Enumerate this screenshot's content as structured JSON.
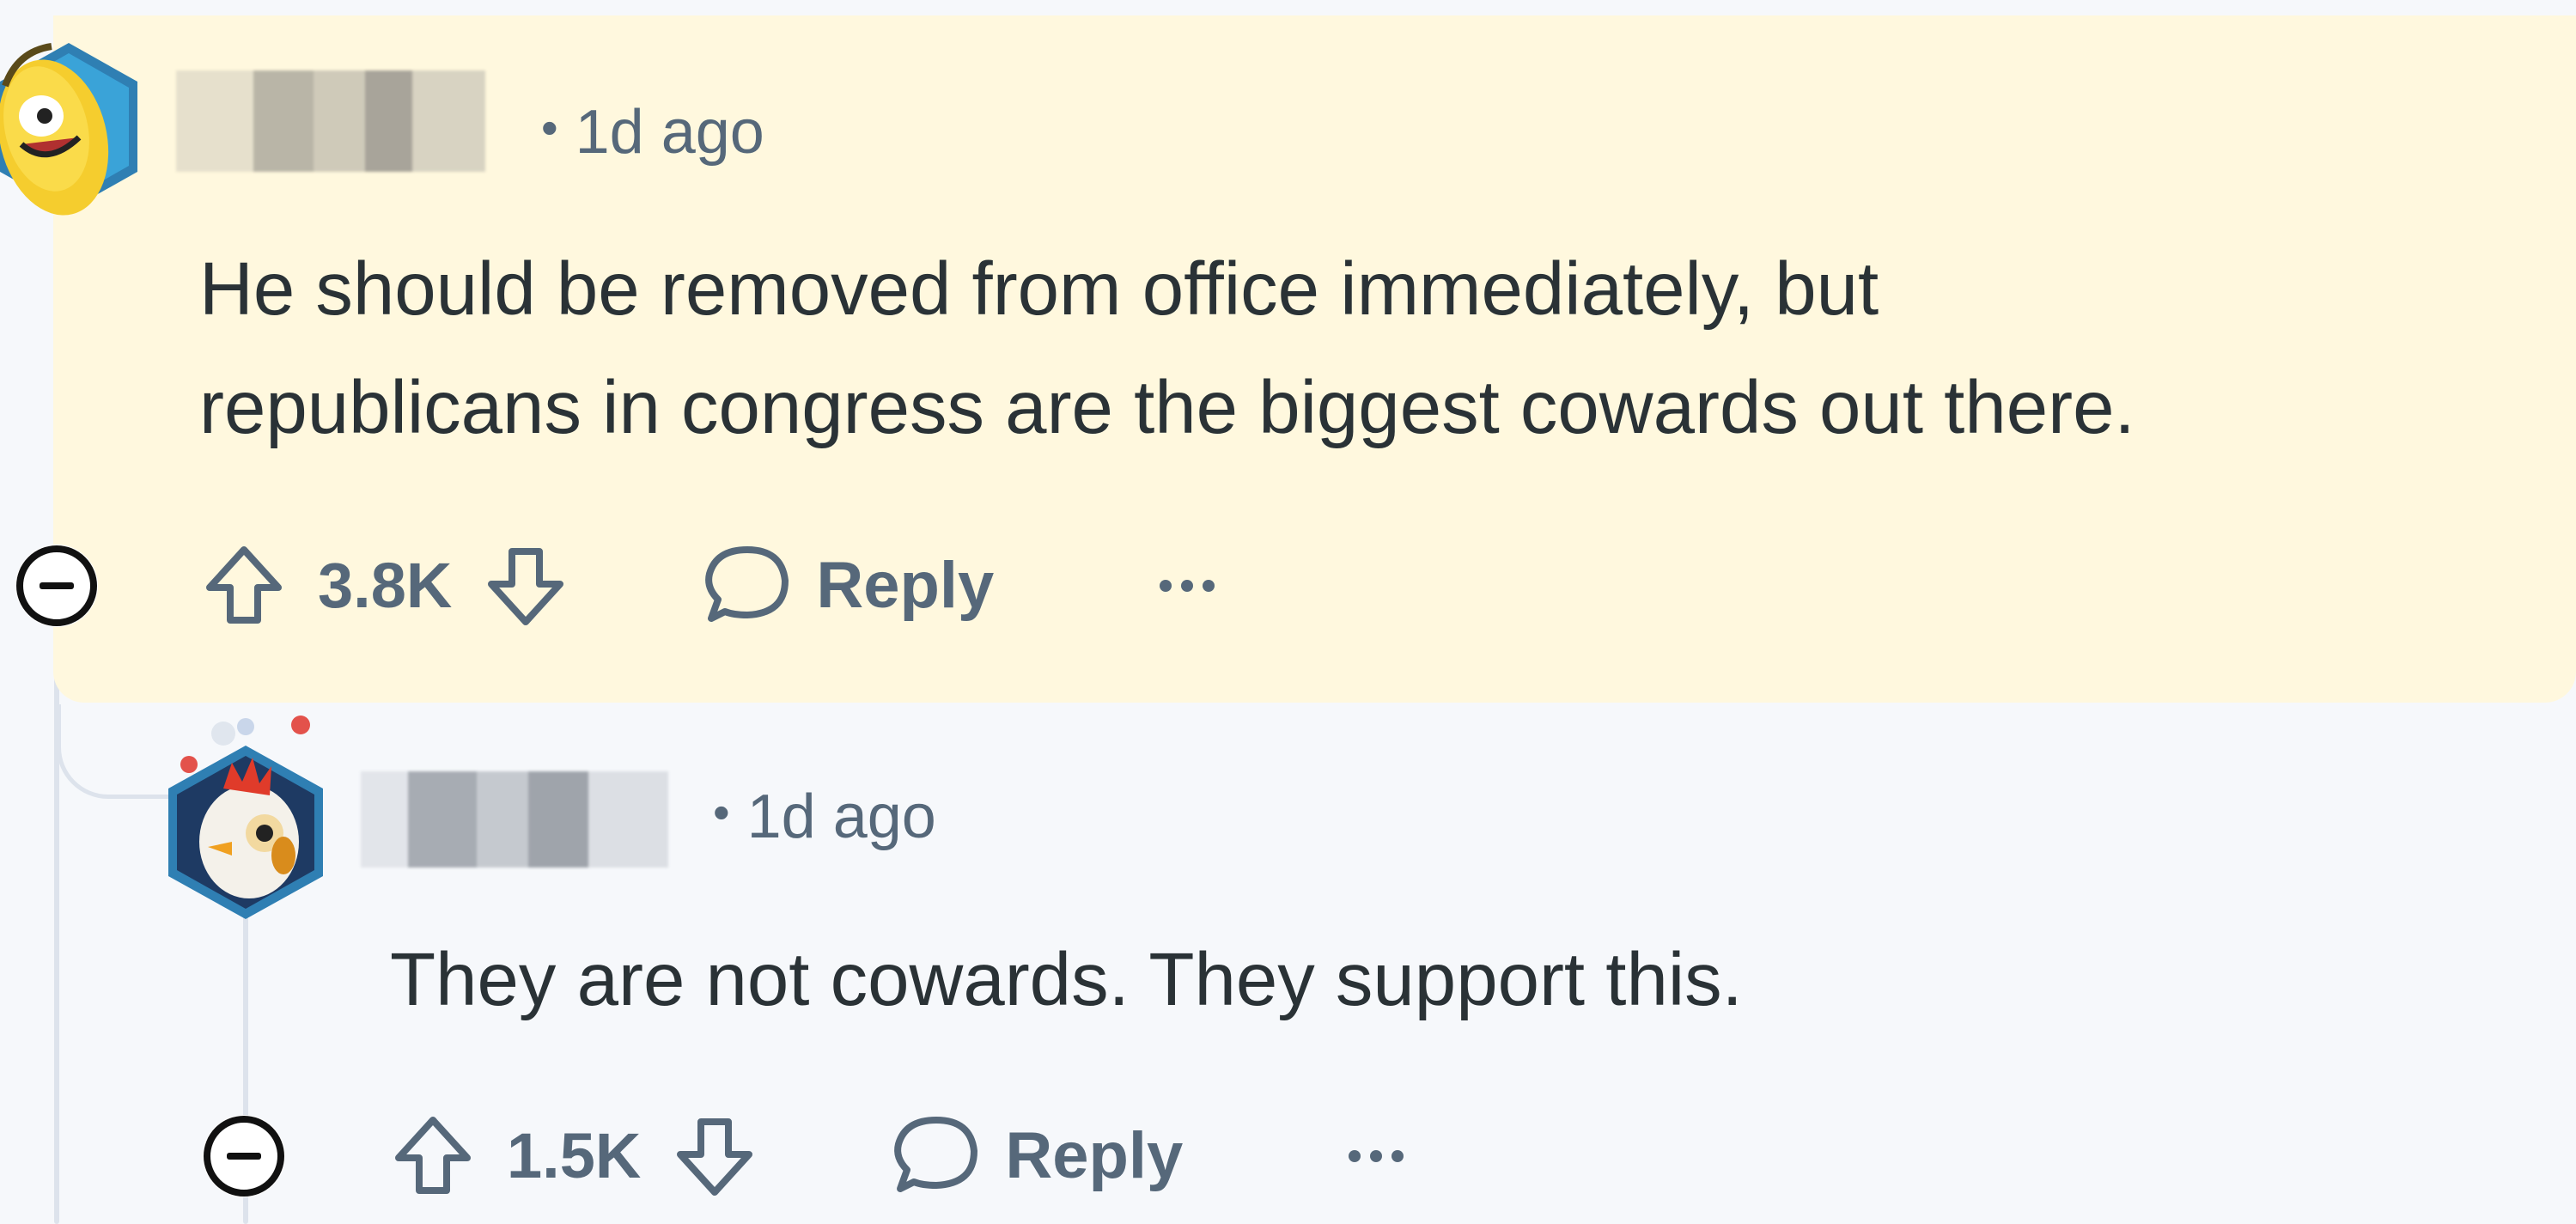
{
  "comment": {
    "avatar_icon": "banana-avatar-icon",
    "username_obscured": true,
    "timestamp": "1d ago",
    "body_lines": [
      "He should be removed from office immediately, but",
      "republicans in congress are the biggest cowards out there."
    ],
    "score": "3.8K",
    "reply_label": "Reply",
    "highlight_color": "#fff8de"
  },
  "reply": {
    "avatar_icon": "chicken-avatar-icon",
    "username_obscured": true,
    "timestamp": "1d ago",
    "body_lines": [
      "They are not cowards. They support this."
    ],
    "score": "1.5K",
    "reply_label": "Reply"
  },
  "colors": {
    "text_primary": "#2a3236",
    "text_secondary": "#56687a",
    "background": "#f6f8fb",
    "thread_line": "#dde3ec"
  }
}
